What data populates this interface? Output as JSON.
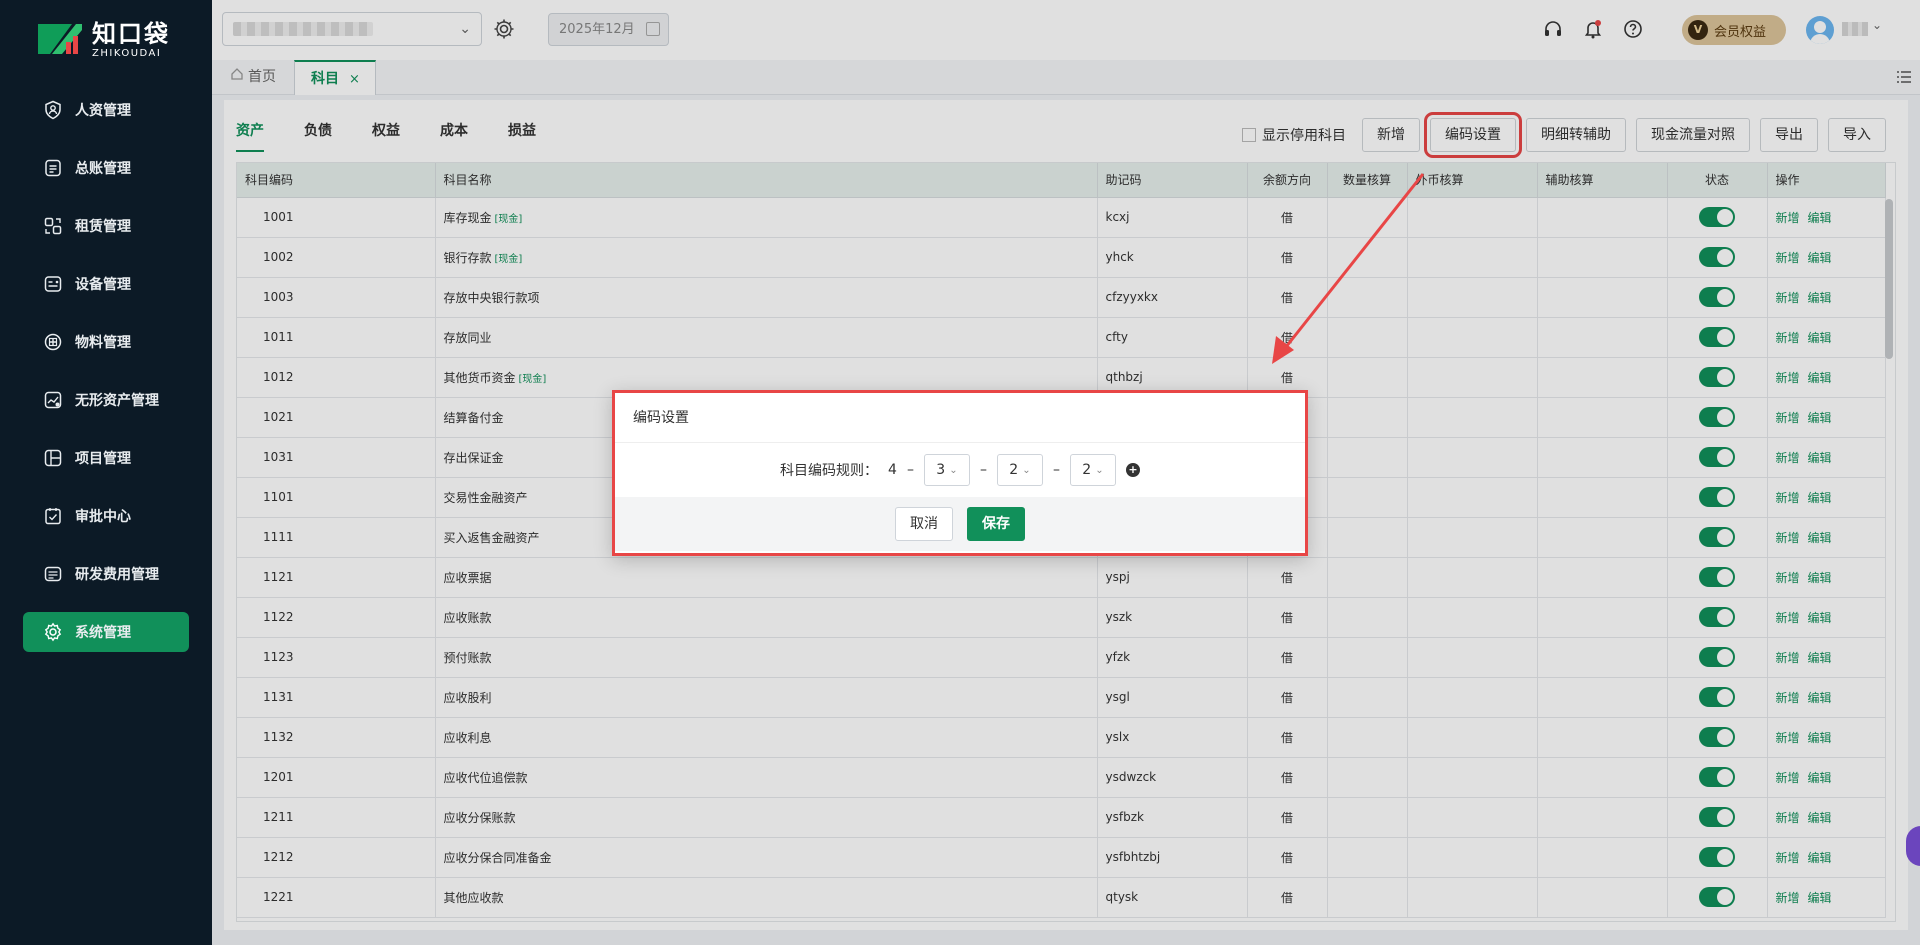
{
  "sidebar": {
    "logo_cn": "知口袋",
    "logo_en": "ZHIKOUDAI",
    "items": [
      {
        "label": "人资管理",
        "icon": "person-shield-icon"
      },
      {
        "label": "总账管理",
        "icon": "ledger-icon"
      },
      {
        "label": "租赁管理",
        "icon": "lease-icon"
      },
      {
        "label": "设备管理",
        "icon": "device-icon"
      },
      {
        "label": "物料管理",
        "icon": "material-icon"
      },
      {
        "label": "无形资产管理",
        "icon": "intangible-asset-icon"
      },
      {
        "label": "项目管理",
        "icon": "project-icon"
      },
      {
        "label": "审批中心",
        "icon": "approval-icon"
      },
      {
        "label": "研发费用管理",
        "icon": "rnd-expense-icon"
      },
      {
        "label": "系统管理",
        "icon": "gear-icon",
        "active": true
      }
    ]
  },
  "header": {
    "period": "2025年12月",
    "member_label": "会员权益",
    "member_badge": "V"
  },
  "tabs": {
    "home": "首页",
    "current": "科目",
    "close": "×"
  },
  "categories": [
    "资产",
    "负债",
    "权益",
    "成本",
    "损益"
  ],
  "toolbar": {
    "show_disabled": "显示停用科目",
    "add": "新增",
    "code_settings": "编码设置",
    "detail_to_aux": "明细转辅助",
    "cashflow_map": "现金流量对照",
    "export": "导出",
    "import": "导入"
  },
  "table": {
    "headers": [
      "科目编码",
      "科目名称",
      "助记码",
      "余额方向",
      "数量核算",
      "外币核算",
      "辅助核算",
      "状态",
      "操作"
    ],
    "cash_tag": "[现金]",
    "op_add": "新增",
    "op_edit": "编辑",
    "rows": [
      {
        "code": "1001",
        "name": "库存现金",
        "cash": true,
        "mnemonic": "kcxj",
        "dir": "借"
      },
      {
        "code": "1002",
        "name": "银行存款",
        "cash": true,
        "mnemonic": "yhck",
        "dir": "借"
      },
      {
        "code": "1003",
        "name": "存放中央银行款项",
        "cash": false,
        "mnemonic": "cfzyyxkx",
        "dir": "借"
      },
      {
        "code": "1011",
        "name": "存放同业",
        "cash": false,
        "mnemonic": "cfty",
        "dir": "借"
      },
      {
        "code": "1012",
        "name": "其他货币资金",
        "cash": true,
        "mnemonic": "qthbzj",
        "dir": "借"
      },
      {
        "code": "1021",
        "name": "结算备付金",
        "cash": false,
        "mnemonic": "",
        "dir": ""
      },
      {
        "code": "1031",
        "name": "存出保证金",
        "cash": false,
        "mnemonic": "",
        "dir": ""
      },
      {
        "code": "1101",
        "name": "交易性金融资产",
        "cash": false,
        "mnemonic": "",
        "dir": ""
      },
      {
        "code": "1111",
        "name": "买入返售金融资产",
        "cash": false,
        "mnemonic": "",
        "dir": ""
      },
      {
        "code": "1121",
        "name": "应收票据",
        "cash": false,
        "mnemonic": "yspj",
        "dir": "借"
      },
      {
        "code": "1122",
        "name": "应收账款",
        "cash": false,
        "mnemonic": "yszk",
        "dir": "借"
      },
      {
        "code": "1123",
        "name": "预付账款",
        "cash": false,
        "mnemonic": "yfzk",
        "dir": "借"
      },
      {
        "code": "1131",
        "name": "应收股利",
        "cash": false,
        "mnemonic": "ysgl",
        "dir": "借"
      },
      {
        "code": "1132",
        "name": "应收利息",
        "cash": false,
        "mnemonic": "yslx",
        "dir": "借"
      },
      {
        "code": "1201",
        "name": "应收代位追偿款",
        "cash": false,
        "mnemonic": "ysdwzck",
        "dir": "借"
      },
      {
        "code": "1211",
        "name": "应收分保账款",
        "cash": false,
        "mnemonic": "ysfbzk",
        "dir": "借"
      },
      {
        "code": "1212",
        "name": "应收分保合同准备金",
        "cash": false,
        "mnemonic": "ysfbhtzbj",
        "dir": "借"
      },
      {
        "code": "1221",
        "name": "其他应收款",
        "cash": false,
        "mnemonic": "qtysk",
        "dir": "借"
      }
    ]
  },
  "modal": {
    "title": "编码设置",
    "rule_label": "科目编码规则：",
    "first_level": "4",
    "dash": "–",
    "levels": [
      "3",
      "2",
      "2"
    ],
    "add_level": "+",
    "cancel": "取消",
    "save": "保存"
  },
  "colors": {
    "brand": "#11905a",
    "sidebar_bg": "#0c1a26",
    "annotation": "#e84646"
  }
}
